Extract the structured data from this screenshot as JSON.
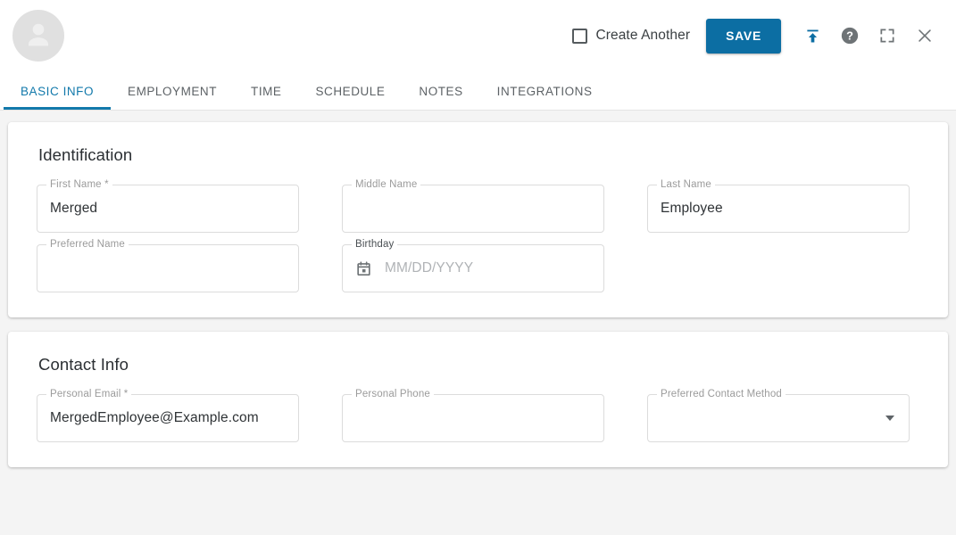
{
  "header": {
    "avatar_icon": "person-avatar-icon",
    "create_another_label": "Create Another",
    "create_another_checked": false,
    "save_label": "SAVE",
    "save_color": "#0c6ea3",
    "icons": {
      "upload": "publish-upload-icon",
      "help": "help-circle-icon",
      "fullscreen": "fullscreen-expand-icon",
      "close": "close-x-icon"
    },
    "upload_icon_color": "#0c6ea3",
    "icon_color": "#6e7376"
  },
  "tabs": {
    "active_color": "#1279ab",
    "items": [
      {
        "label": "BASIC INFO",
        "active": true
      },
      {
        "label": "EMPLOYMENT",
        "active": false
      },
      {
        "label": "TIME",
        "active": false
      },
      {
        "label": "SCHEDULE",
        "active": false
      },
      {
        "label": "NOTES",
        "active": false
      },
      {
        "label": "INTEGRATIONS",
        "active": false
      }
    ]
  },
  "cards": [
    {
      "title": "Identification",
      "rows": [
        [
          {
            "label": "First Name",
            "required": true,
            "value": "Merged",
            "placeholder": "",
            "type": "text"
          },
          {
            "label": "Middle Name",
            "required": false,
            "value": "",
            "placeholder": "",
            "type": "text"
          },
          {
            "label": "Last Name",
            "required": false,
            "value": "Employee",
            "placeholder": "",
            "type": "text"
          }
        ],
        [
          {
            "label": "Preferred Name",
            "required": false,
            "value": "",
            "placeholder": "",
            "type": "text"
          },
          {
            "label": "Birthday",
            "required": false,
            "value": "",
            "placeholder": "MM/DD/YYYY",
            "type": "date",
            "icon": "calendar-icon",
            "label_dark": true
          }
        ]
      ]
    },
    {
      "title": "Contact Info",
      "rows": [
        [
          {
            "label": "Personal Email",
            "required": true,
            "value": "MergedEmployee@Example.com",
            "placeholder": "",
            "type": "email"
          },
          {
            "label": "Personal Phone",
            "required": false,
            "value": "",
            "placeholder": "",
            "type": "tel"
          },
          {
            "label": "Preferred Contact Method",
            "required": false,
            "value": "",
            "placeholder": "",
            "type": "select"
          }
        ]
      ]
    }
  ]
}
